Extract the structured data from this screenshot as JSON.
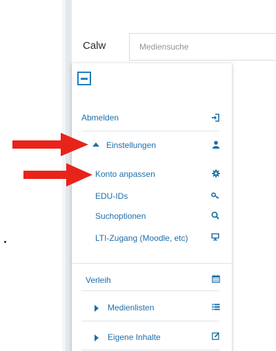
{
  "header": {
    "location": "Calw",
    "search_placeholder": "Mediensuche"
  },
  "menu": {
    "logout_label": "Abmelden",
    "settings_label": "Einstellungen",
    "settings_sub": [
      {
        "label": "Konto anpassen",
        "icon": "gear-icon"
      },
      {
        "label": "EDU-IDs",
        "icon": "key-icon"
      },
      {
        "label": "Suchoptionen",
        "icon": "search-icon"
      },
      {
        "label": "LTI-Zugang (Moodle, etc)",
        "icon": "monitor-icon"
      }
    ],
    "lending_label": "Verleih",
    "media_lists_label": "Medienlisten",
    "own_content_label": "Eigene Inhalte"
  },
  "colors": {
    "link": "#1d6ea8",
    "accent": "#1d7fc1",
    "annotation_arrow": "#e8231a"
  }
}
